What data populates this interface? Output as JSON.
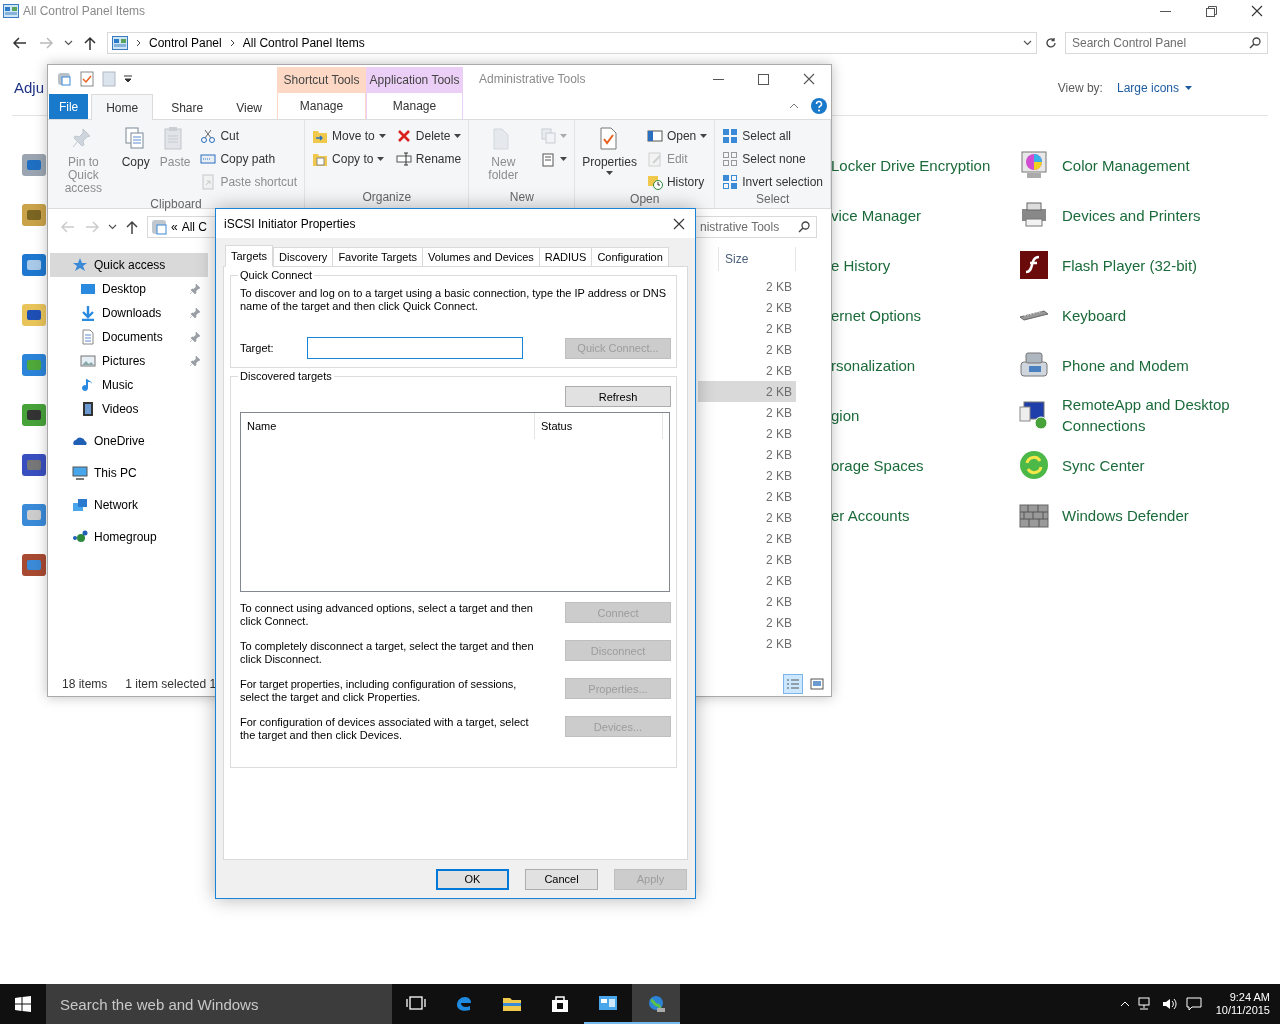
{
  "control_panel": {
    "title": "All Control Panel Items",
    "breadcrumb": [
      "Control Panel",
      "All Control Panel Items"
    ],
    "search_placeholder": "Search Control Panel",
    "heading": "Adju",
    "view_by": {
      "label": "View by:",
      "value": "Large icons"
    },
    "column_2": [
      "Locker Drive Encryption",
      "vice Manager",
      "e History",
      "ernet Options",
      "rsonalization",
      "gion",
      "orage Spaces",
      "er Accounts"
    ],
    "column_3": [
      "Color Management",
      "Devices and Printers",
      "Flash Player (32-bit)",
      "Keyboard",
      "Phone and Modem",
      "RemoteApp and Desktop Connections",
      "Sync Center",
      "Windows Defender"
    ]
  },
  "explorer": {
    "title": "Administrative Tools",
    "file_tab": "File",
    "context_tabs": [
      {
        "label": "Shortcut Tools",
        "tab": "Manage",
        "color": "#fcd8c5"
      },
      {
        "label": "Application Tools",
        "tab": "Manage",
        "color": "#ebcff7"
      }
    ],
    "tabs": [
      {
        "label": "Home",
        "selected": true
      },
      {
        "label": "Share",
        "selected": false
      },
      {
        "label": "View",
        "selected": false
      }
    ],
    "ribbon": {
      "groups": [
        {
          "label": "Clipboard",
          "items": [
            {
              "kind": "large",
              "label": "Pin to Quick access",
              "menu": false,
              "disabled": true
            },
            {
              "kind": "large",
              "label": "Copy",
              "menu": false,
              "disabled": false
            },
            {
              "kind": "large",
              "label": "Paste",
              "menu": false,
              "disabled": true
            },
            {
              "kind": "stack",
              "commands": [
                {
                  "label": "Cut",
                  "menu": false,
                  "disabled": false
                },
                {
                  "label": "Copy path",
                  "menu": false,
                  "disabled": false
                },
                {
                  "label": "Paste shortcut",
                  "menu": false,
                  "disabled": true
                }
              ]
            }
          ]
        },
        {
          "label": "Organize",
          "items": [
            {
              "kind": "stack",
              "commands": [
                {
                  "label": "Move to",
                  "menu": true,
                  "disabled": false
                },
                {
                  "label": "Copy to",
                  "menu": true,
                  "disabled": false
                }
              ]
            },
            {
              "kind": "stack",
              "commands": [
                {
                  "label": "Delete",
                  "menu": true,
                  "disabled": false
                },
                {
                  "label": "Rename",
                  "menu": false,
                  "disabled": false
                }
              ]
            }
          ]
        },
        {
          "label": "New",
          "items": [
            {
              "kind": "large",
              "label": "New folder",
              "menu": false,
              "disabled": true
            },
            {
              "kind": "stack",
              "commands": [
                {
                  "menu": true,
                  "disabled": true
                },
                {
                  "menu": true,
                  "disabled": false
                }
              ]
            }
          ]
        },
        {
          "label": "Open",
          "items": [
            {
              "kind": "large",
              "label": "Properties",
              "menu": true,
              "disabled": false
            },
            {
              "kind": "stack",
              "commands": [
                {
                  "label": "Open",
                  "menu": true,
                  "disabled": false
                },
                {
                  "label": "Edit",
                  "menu": false,
                  "disabled": true
                },
                {
                  "label": "History",
                  "menu": false,
                  "disabled": false
                }
              ]
            }
          ]
        },
        {
          "label": "Select",
          "items": [
            {
              "kind": "stack",
              "commands": [
                {
                  "label": "Select all",
                  "menu": false,
                  "disabled": false
                },
                {
                  "label": "Select none",
                  "menu": false,
                  "disabled": false
                },
                {
                  "label": "Invert selection",
                  "menu": false,
                  "disabled": false
                }
              ]
            }
          ]
        }
      ]
    },
    "address": {
      "prefix": "«",
      "text": "All C"
    },
    "search_placeholder": "nistrative Tools",
    "nav": [
      {
        "label": "Quick access",
        "selected": true,
        "children": [
          {
            "label": "Desktop",
            "pinned": true,
            "selected": false
          },
          {
            "label": "Downloads",
            "pinned": true,
            "selected": false
          },
          {
            "label": "Documents",
            "pinned": true,
            "selected": false
          },
          {
            "label": "Pictures",
            "pinned": true,
            "selected": false
          },
          {
            "label": "Music",
            "pinned": false,
            "selected": false
          },
          {
            "label": "Videos",
            "pinned": false,
            "selected": false
          }
        ]
      },
      {
        "label": "OneDrive",
        "selected": false
      },
      {
        "label": "This PC",
        "selected": false
      },
      {
        "label": "Network",
        "selected": false
      },
      {
        "label": "Homegroup",
        "selected": false
      }
    ],
    "file_list": {
      "column": "Size",
      "rows": [
        {
          "size": "2 KB",
          "selected": false
        },
        {
          "size": "2 KB",
          "selected": false
        },
        {
          "size": "2 KB",
          "selected": false
        },
        {
          "size": "2 KB",
          "selected": false
        },
        {
          "size": "2 KB",
          "selected": false
        },
        {
          "size": "2 KB",
          "selected": true
        },
        {
          "size": "2 KB",
          "selected": false
        },
        {
          "size": "2 KB",
          "selected": false
        },
        {
          "size": "2 KB",
          "selected": false
        },
        {
          "size": "2 KB",
          "selected": false
        },
        {
          "size": "2 KB",
          "selected": false
        },
        {
          "size": "2 KB",
          "selected": false
        },
        {
          "size": "2 KB",
          "selected": false
        },
        {
          "size": "2 KB",
          "selected": false
        },
        {
          "size": "2 KB",
          "selected": false
        },
        {
          "size": "2 KB",
          "selected": false
        },
        {
          "size": "2 KB",
          "selected": false
        },
        {
          "size": "2 KB",
          "selected": false
        }
      ]
    },
    "status": {
      "count": "18 items",
      "selection": "1 item selected 1"
    },
    "view_buttons": [
      {
        "selected": true
      },
      {
        "selected": false
      }
    ]
  },
  "dialog": {
    "title": "iSCSI Initiator Properties",
    "tabs": [
      {
        "label": "Targets",
        "selected": true
      },
      {
        "label": "Discovery",
        "selected": false
      },
      {
        "label": "Favorite Targets",
        "selected": false
      },
      {
        "label": "Volumes and Devices",
        "selected": false
      },
      {
        "label": "RADIUS",
        "selected": false
      },
      {
        "label": "Configuration",
        "selected": false
      }
    ],
    "quick_connect": {
      "legend": "Quick Connect",
      "description": "To discover and log on to a target using a basic connection, type the IP address or DNS name of the target and then click Quick Connect.",
      "target_label": "Target:",
      "target_focused": true,
      "button": {
        "label": "Quick Connect...",
        "disabled": true
      }
    },
    "discovered": {
      "legend": "Discovered targets",
      "refresh": {
        "label": "Refresh",
        "disabled": false
      },
      "columns": [
        "Name",
        "Status"
      ],
      "actions": [
        {
          "text": "To connect using advanced options, select a target and then click Connect.",
          "button": {
            "label": "Connect",
            "disabled": true
          }
        },
        {
          "text": "To completely disconnect a target, select the target and then click Disconnect.",
          "button": {
            "label": "Disconnect",
            "disabled": true
          }
        },
        {
          "text": "For target properties, including configuration of sessions, select the target and click Properties.",
          "button": {
            "label": "Properties...",
            "disabled": true
          }
        },
        {
          "text": "For configuration of devices associated with a target, select the target and then click Devices.",
          "button": {
            "label": "Devices...",
            "disabled": true
          }
        }
      ]
    },
    "footer": [
      {
        "label": "OK",
        "default": true,
        "disabled": false
      },
      {
        "label": "Cancel",
        "default": false,
        "disabled": false
      },
      {
        "label": "Apply",
        "default": false,
        "disabled": true
      }
    ]
  },
  "taskbar": {
    "search_placeholder": "Search the web and Windows",
    "apps": [
      {
        "kind": "taskview",
        "running": false,
        "selected": false
      },
      {
        "kind": "edge",
        "running": false,
        "selected": false
      },
      {
        "kind": "explorer",
        "running": false,
        "selected": false
      },
      {
        "kind": "store",
        "running": false,
        "selected": false
      },
      {
        "kind": "controlpanel",
        "running": true,
        "selected": false
      },
      {
        "kind": "iscsi",
        "running": true,
        "selected": true
      }
    ],
    "time": "9:24 AM",
    "date": "10/11/2015"
  }
}
